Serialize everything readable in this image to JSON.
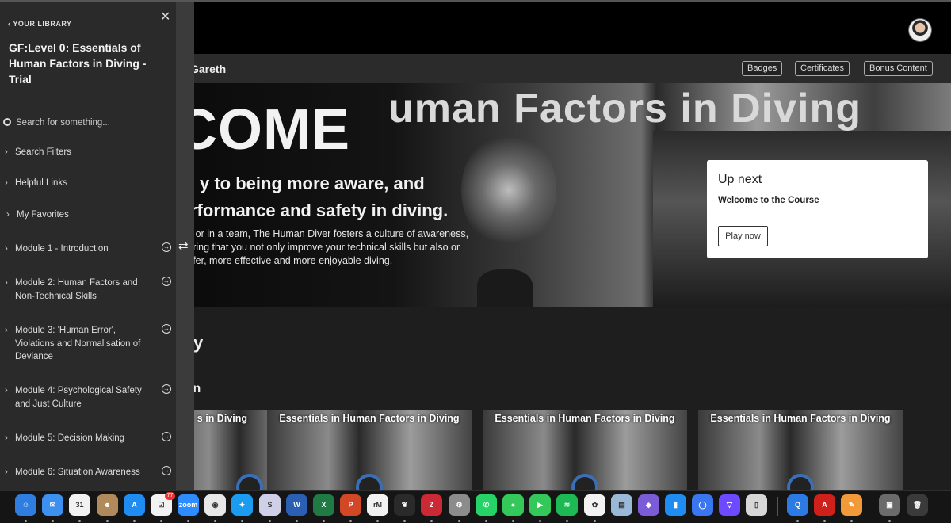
{
  "header": {
    "greeting": "Gareth",
    "badges_label": "Badges",
    "certificates_label": "Certificates",
    "bonus_label": "Bonus Content"
  },
  "hero": {
    "bg_title": "uman Factors in Diving",
    "welcome": "COME",
    "tagline_1": "y to being more aware, and",
    "tagline_2": "rformance and safety in diving.",
    "paragraph": "dy or in a team, The Human Diver fosters a culture of awareness, suring that you not only improve your technical skills but also or safer, more effective and more enjoyable diving."
  },
  "up_next": {
    "heading": "Up next",
    "lesson": "Welcome to the Course",
    "button": "Play now"
  },
  "sections": {
    "library": "ory",
    "collection": "tion"
  },
  "cards": [
    {
      "title": "s in Diving"
    },
    {
      "title": "Essentials in Human Factors in Diving"
    },
    {
      "title": "Essentials in Human Factors in Diving"
    },
    {
      "title": "Essentials in Human Factors in Diving"
    }
  ],
  "sidebar": {
    "back_label": "YOUR LIBRARY",
    "course_title": "GF:Level 0: Essentials of Human Factors in Diving - Trial",
    "search_placeholder": "Search for something...",
    "items": [
      {
        "label": "Search Filters"
      },
      {
        "label": "Helpful Links"
      },
      {
        "label": "My Favorites"
      },
      {
        "label": "Module 1 - Introduction"
      },
      {
        "label": "Module 2: Human Factors and Non-Technical Skills"
      },
      {
        "label": "Module 3: 'Human Error', Violations and Normalisation of Deviance"
      },
      {
        "label": "Module 4: Psychological Safety and Just Culture"
      },
      {
        "label": "Module 5: Decision Making"
      },
      {
        "label": "Module 6: Situation Awareness"
      }
    ]
  },
  "dock": {
    "reminders_badge": "77",
    "apps": [
      {
        "name": "finder-icon",
        "glyph": "☺",
        "color": "#2f7de1"
      },
      {
        "name": "mail-icon",
        "glyph": "✉",
        "color": "#3d8ff0"
      },
      {
        "name": "calendar-icon",
        "glyph": "31",
        "color": "#f2f2f2"
      },
      {
        "name": "contacts-icon",
        "glyph": "☻",
        "color": "#b08a5a"
      },
      {
        "name": "app-store-icon",
        "glyph": "A",
        "color": "#1e8cf2"
      },
      {
        "name": "reminders-icon",
        "glyph": "☑",
        "color": "#f2f2f2"
      },
      {
        "name": "zoom-icon",
        "glyph": "zoom",
        "color": "#2d8cff"
      },
      {
        "name": "chrome-icon",
        "glyph": "◉",
        "color": "#e8e8e8"
      },
      {
        "name": "safari-icon",
        "glyph": "✦",
        "color": "#1a9cf0"
      },
      {
        "name": "scrivener-icon",
        "glyph": "S",
        "color": "#cfcfe8"
      },
      {
        "name": "word-icon",
        "glyph": "W",
        "color": "#2b5fb4"
      },
      {
        "name": "excel-icon",
        "glyph": "X",
        "color": "#1f7a43"
      },
      {
        "name": "powerpoint-icon",
        "glyph": "P",
        "color": "#d24726"
      },
      {
        "name": "remnote-icon",
        "glyph": "rM",
        "color": "#f2f2f2"
      },
      {
        "name": "evernote-icon",
        "glyph": "❦",
        "color": "#2a2a2a"
      },
      {
        "name": "zotero-icon",
        "glyph": "Z",
        "color": "#cc2936"
      },
      {
        "name": "system-settings-icon",
        "glyph": "⚙",
        "color": "#8c8c8c"
      },
      {
        "name": "whatsapp-icon",
        "glyph": "✆",
        "color": "#25d366"
      },
      {
        "name": "messages-icon",
        "glyph": "●",
        "color": "#34c759"
      },
      {
        "name": "facetime-icon",
        "glyph": "▶",
        "color": "#34c759"
      },
      {
        "name": "spotify-icon",
        "glyph": "≋",
        "color": "#1db954"
      },
      {
        "name": "photos-icon",
        "glyph": "✿",
        "color": "#f2f2f2"
      },
      {
        "name": "preview-icon",
        "glyph": "▤",
        "color": "#9ab8d8"
      },
      {
        "name": "obsidian-icon",
        "glyph": "◆",
        "color": "#7c5cd6"
      },
      {
        "name": "books-icon",
        "glyph": "▮",
        "color": "#1e8cf2"
      },
      {
        "name": "signal-icon",
        "glyph": "◯",
        "color": "#3a76f0"
      },
      {
        "name": "proton-vpn-icon",
        "glyph": "▽",
        "color": "#6d4aff"
      },
      {
        "name": "pdf-app-icon",
        "glyph": "▯",
        "color": "#d7d7d7"
      },
      {
        "name": "quicktime-icon",
        "glyph": "Q",
        "color": "#2c7be5"
      },
      {
        "name": "acrobat-icon",
        "glyph": "A",
        "color": "#d0201c"
      },
      {
        "name": "pages-icon",
        "glyph": "✎",
        "color": "#f29a3a"
      },
      {
        "name": "image-capture-icon",
        "glyph": "▣",
        "color": "#6b6b6b"
      },
      {
        "name": "trash-icon",
        "glyph": "🗑",
        "color": "#3a3a3a"
      }
    ]
  }
}
